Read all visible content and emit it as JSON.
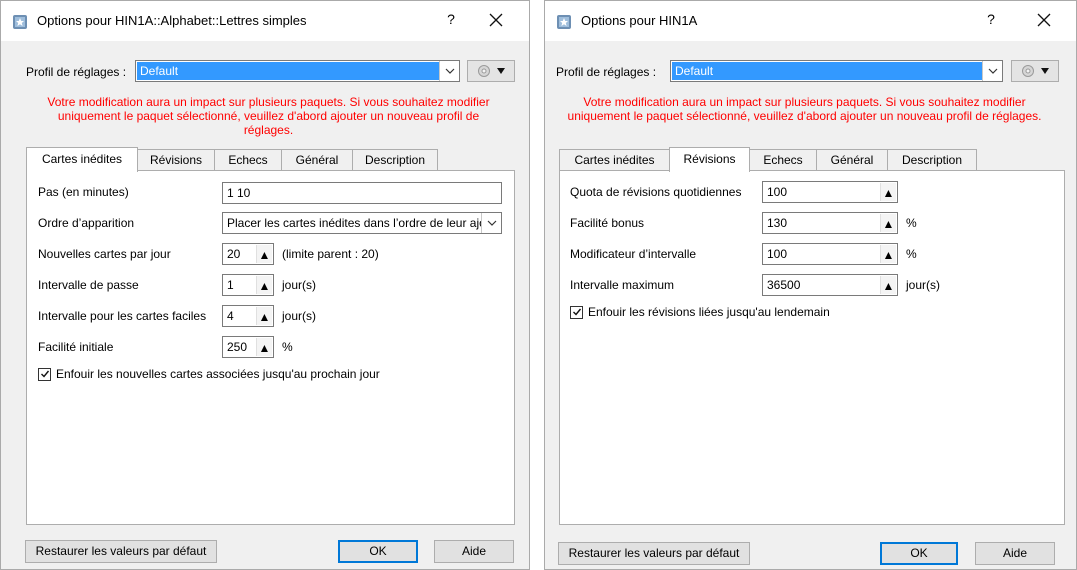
{
  "left_dialog": {
    "title": "Options pour HIN1A::Alphabet::Lettres simples",
    "help": "?",
    "profile_label": "Profil de réglages :",
    "profile_value": "Default",
    "warning": "Votre modification aura un impact sur plusieurs paquets. Si vous souhaitez modifier uniquement le paquet sélectionné, veuillez d'abord ajouter un nouveau profil de réglages.",
    "tabs": [
      "Cartes inédites",
      "Révisions",
      "Echecs",
      "Général",
      "Description"
    ],
    "active_tab": "Cartes inédites",
    "fields": {
      "steps_label": "Pas (en minutes)",
      "steps_value": "1 10",
      "order_label": "Ordre d’apparition",
      "order_value": "Placer les cartes inédites dans l’ordre de leur ajout",
      "per_day_label": "Nouvelles cartes par jour",
      "per_day_value": "20",
      "per_day_note": "(limite parent : 20)",
      "grad_label": "Intervalle de passe",
      "grad_value": "1",
      "grad_unit": "jour(s)",
      "easy_label": "Intervalle pour les cartes faciles",
      "easy_value": "4",
      "easy_unit": "jour(s)",
      "ease_label": "Facilité initiale",
      "ease_value": "250",
      "ease_unit": "%",
      "bury_label": "Enfouir les nouvelles cartes associées jusqu'au prochain jour"
    },
    "bury_checked": true,
    "restore_label": "Restaurer les valeurs par défaut",
    "ok_label": "OK",
    "help_label": "Aide"
  },
  "right_dialog": {
    "title": "Options pour HIN1A",
    "help": "?",
    "profile_label": "Profil de réglages :",
    "profile_value": "Default",
    "warning": "Votre modification aura un impact sur plusieurs paquets. Si vous souhaitez modifier uniquement le paquet sélectionné, veuillez d'abord ajouter un nouveau profil de réglages.",
    "tabs": [
      "Cartes inédites",
      "Révisions",
      "Echecs",
      "Général",
      "Description"
    ],
    "active_tab": "Révisions",
    "fields": {
      "quota_label": "Quota de révisions quotidiennes",
      "quota_value": "100",
      "bonus_label": "Facilité bonus",
      "bonus_value": "130",
      "bonus_unit": "%",
      "modifier_label": "Modificateur d’intervalle",
      "modifier_value": "100",
      "modifier_unit": "%",
      "max_label": "Intervalle maximum",
      "max_value": "36500",
      "max_unit": "jour(s)",
      "bury_label": "Enfouir les révisions liées jusqu'au lendemain"
    },
    "bury_checked": true,
    "restore_label": "Restaurer les valeurs par défaut",
    "ok_label": "OK",
    "help_label": "Aide"
  },
  "icons": [
    "anki-app-icon",
    "close-icon",
    "chevron-down-icon",
    "gear-icon",
    "checkmark-icon",
    "spin-up-icon",
    "spin-down-icon"
  ],
  "colors": {
    "warning": "#ff0000",
    "selection": "#3399ff",
    "dialog_bg": "#f0f0f0",
    "default_button_border": "#0078d7"
  }
}
